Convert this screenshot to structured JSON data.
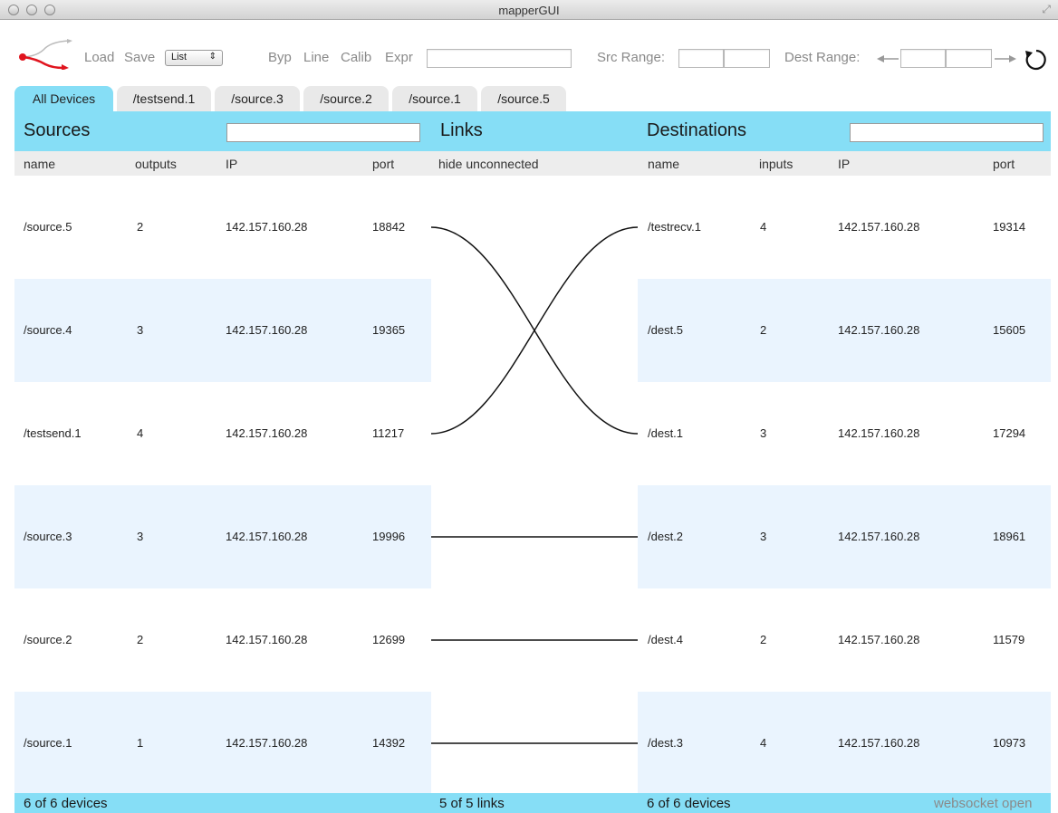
{
  "window": {
    "title": "mapperGUI"
  },
  "toolbar": {
    "load": "Load",
    "save": "Save",
    "view_select": "List",
    "byp": "Byp",
    "line": "Line",
    "calib": "Calib",
    "expr": "Expr",
    "src_range": "Src Range:",
    "dest_range": "Dest Range:"
  },
  "tabs": [
    "All Devices",
    "/testsend.1",
    "/source.3",
    "/source.2",
    "/source.1",
    "/source.5"
  ],
  "sources": {
    "title": "Sources",
    "columns": [
      "name",
      "outputs",
      "IP",
      "port"
    ],
    "rows": [
      {
        "name": "/source.5",
        "outputs": "2",
        "ip": "142.157.160.28",
        "port": "18842"
      },
      {
        "name": "/source.4",
        "outputs": "3",
        "ip": "142.157.160.28",
        "port": "19365"
      },
      {
        "name": "/testsend.1",
        "outputs": "4",
        "ip": "142.157.160.28",
        "port": "11217"
      },
      {
        "name": "/source.3",
        "outputs": "3",
        "ip": "142.157.160.28",
        "port": "19996"
      },
      {
        "name": "/source.2",
        "outputs": "2",
        "ip": "142.157.160.28",
        "port": "12699"
      },
      {
        "name": "/source.1",
        "outputs": "1",
        "ip": "142.157.160.28",
        "port": "14392"
      }
    ],
    "footer": "6 of 6 devices"
  },
  "links": {
    "title": "Links",
    "hide_unconnected": "hide unconnected",
    "footer": "5 of 5 links"
  },
  "destinations": {
    "title": "Destinations",
    "columns": [
      "name",
      "inputs",
      "IP",
      "port"
    ],
    "rows": [
      {
        "name": "/testrecv.1",
        "inputs": "4",
        "ip": "142.157.160.28",
        "port": "19314"
      },
      {
        "name": "/dest.5",
        "inputs": "2",
        "ip": "142.157.160.28",
        "port": "15605"
      },
      {
        "name": "/dest.1",
        "inputs": "3",
        "ip": "142.157.160.28",
        "port": "17294"
      },
      {
        "name": "/dest.2",
        "inputs": "3",
        "ip": "142.157.160.28",
        "port": "18961"
      },
      {
        "name": "/dest.4",
        "inputs": "2",
        "ip": "142.157.160.28",
        "port": "11579"
      },
      {
        "name": "/dest.3",
        "inputs": "4",
        "ip": "142.157.160.28",
        "port": "10973"
      }
    ],
    "footer": "6 of 6 devices"
  },
  "status": "websocket open",
  "colors": {
    "accent": "#86def6",
    "row_shade": "#eaf4fe",
    "header_gray": "#ededed",
    "logo_red": "#e0141e"
  },
  "icons": {
    "logo": "mapper-logo-icon",
    "refresh": "refresh-icon",
    "arrow_left": "arrow-left-icon",
    "arrow_right": "arrow-right-icon"
  }
}
